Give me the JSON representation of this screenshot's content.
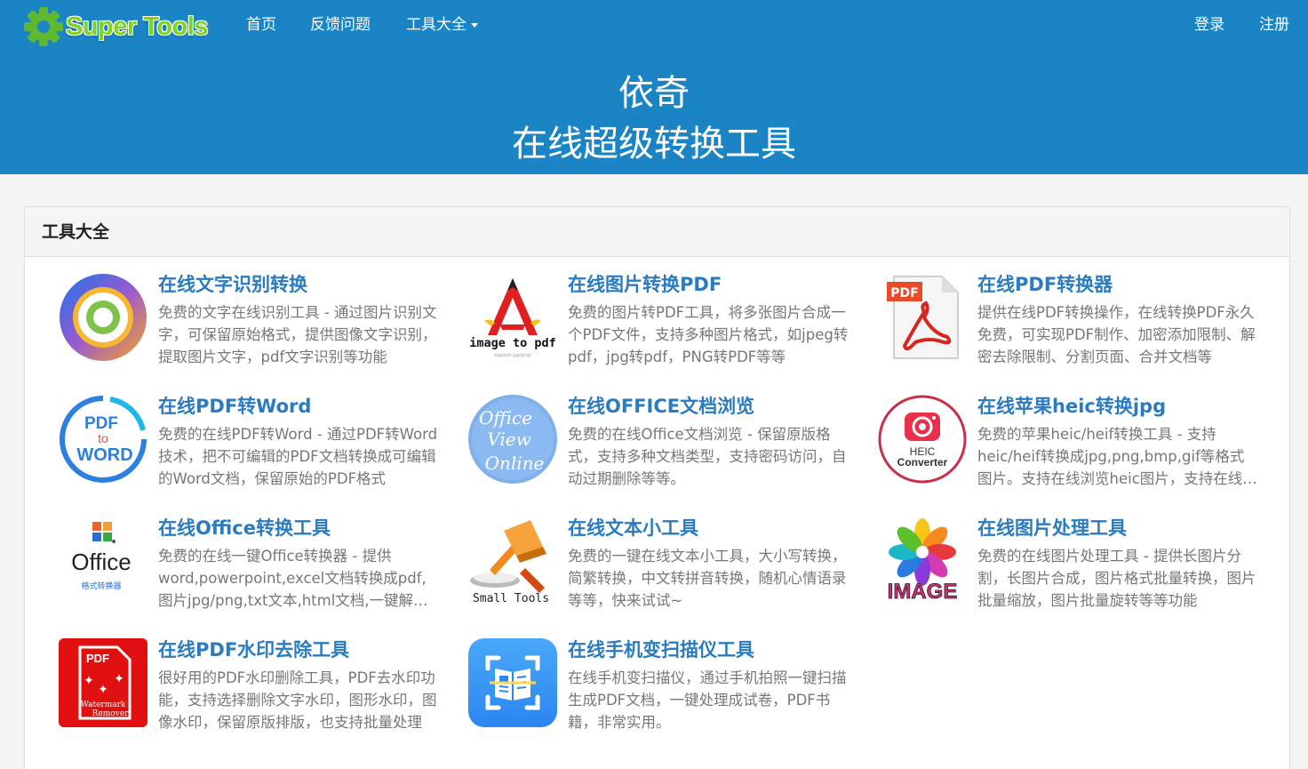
{
  "brand": {
    "name": "Super Tools"
  },
  "nav": {
    "home": "首页",
    "feedback": "反馈问题",
    "tools": "工具大全",
    "login": "登录",
    "register": "注册"
  },
  "hero": {
    "line1": "依奇",
    "line2": "在线超级转换工具"
  },
  "panel": {
    "title": "工具大全"
  },
  "tools": [
    {
      "name": "在线文字识别转换",
      "desc": "免费的文字在线识别工具 - 通过图片识别文字，可保留原始格式，提供图像文字识别，提取图片文字，pdf文字识别等功能",
      "icon": "ocr-icon"
    },
    {
      "name": "在线图片转换PDF",
      "desc": "免费的图片转PDF工具，将多张图片合成一个PDF文件，支持多种图片格式，如jpeg转pdf，jpg转pdf，PNG转PDF等等",
      "icon": "image-to-pdf-icon",
      "icon_text": "image to pdf",
      "icon_sub": "support jpg/png/"
    },
    {
      "name": "在线PDF转换器",
      "desc": "提供在线PDF转换操作，在线转换PDF永久免费，可实现PDF制作、加密添加限制、解密去除限制、分割页面、合并文档等",
      "icon": "pdf-converter-icon",
      "icon_text": "PDF"
    },
    {
      "name": "在线PDF转Word",
      "desc": "免费的在线PDF转Word - 通过PDF转Word技术，把不可编辑的PDF文档转换成可编辑的Word文档，保留原始的PDF格式",
      "icon": "pdf-to-word-icon",
      "icon_text": [
        "PDF",
        "to",
        "WORD"
      ]
    },
    {
      "name": "在线OFFICE文档浏览",
      "desc": "免费的在线Office文档浏览 - 保留原版格式，支持多种文档类型，支持密码访问，自动过期删除等等。",
      "icon": "office-view-online-icon",
      "icon_text": [
        "Office",
        "View",
        "Online"
      ]
    },
    {
      "name": "在线苹果heic转换jpg",
      "desc": "免费的苹果heic/heif转换工具 - 支持heic/heif转换成jpg,png,bmp,gif等格式图片。支持在线浏览heic图片，支持在线批量转换",
      "icon": "heic-converter-icon",
      "icon_text": [
        "HEIC",
        "Converter"
      ]
    },
    {
      "name": "在线Office转换工具",
      "desc": "免费的在线一键Office转换器 - 提供word,powerpoint,excel文档转换成pdf,图片jpg/png,txt文本,html文档,一键解除文档限制等功能",
      "icon": "office-converter-icon",
      "icon_text": [
        "Office",
        "格式转换器"
      ]
    },
    {
      "name": "在线文本小工具",
      "desc": "免费的一键在线文本小工具，大小写转换，简繁转换，中文转拼音转换，随机心情语录等等，快来试试~",
      "icon": "small-tools-icon",
      "icon_text": "Small Tools"
    },
    {
      "name": "在线图片处理工具",
      "desc": "免费的在线图片处理工具 - 提供长图片分割，长图片合成，图片格式批量转换，图片批量缩放，图片批量旋转等等功能",
      "icon": "image-tools-icon",
      "icon_text": "IMAGE"
    },
    {
      "name": "在线PDF水印去除工具",
      "desc": "很好用的PDF水印删除工具，PDF去水印功能，支持选择删除文字水印，图形水印，图像水印，保留原版排版，也支持批量处理",
      "icon": "watermark-remover-icon",
      "icon_text": [
        "PDF",
        "Watermark",
        "Remover"
      ]
    },
    {
      "name": "在线手机变扫描仪工具",
      "desc": "在线手机变扫描仪，通过手机拍照一键扫描生成PDF文档，一键处理成试卷，PDF书籍，非常实用。",
      "icon": "scanner-icon"
    }
  ]
}
